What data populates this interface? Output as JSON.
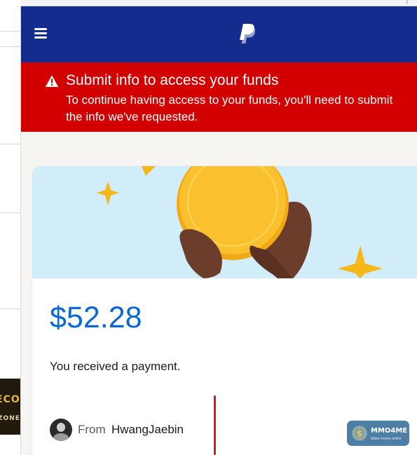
{
  "header": {
    "menu_icon": "hamburger-menu-icon",
    "logo_icon": "paypal-logo-icon",
    "background_color": "#142c8e"
  },
  "alert": {
    "icon": "warning-triangle-icon",
    "title": "Submit info to access your funds",
    "message": "To continue having access to your funds, you'll need to submit the info we've requested.",
    "background_color": "#d20000"
  },
  "payment": {
    "illustration": "hand-holding-gold-coin-with-sparkles",
    "amount": "$52.28",
    "amount_color": "#0b66d6",
    "status_text": "You received a payment.",
    "from_label": "From",
    "sender_name": "HwangJaebin"
  },
  "background_page": {
    "banner_text_top": "ECOU",
    "banner_text_bottom": "ZONE"
  },
  "watermark": {
    "name": "MMO4ME",
    "tagline": "Make money online",
    "icon": "dollar-coin-icon"
  }
}
